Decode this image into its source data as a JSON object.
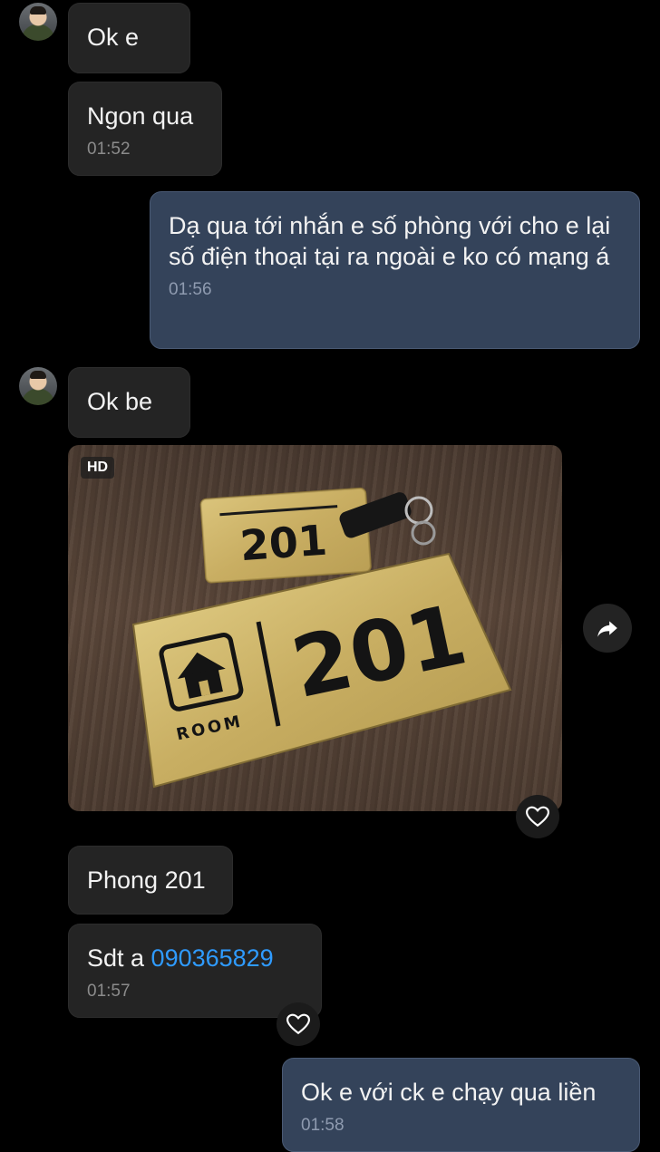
{
  "messages": {
    "m1": {
      "text": "Ok e"
    },
    "m2": {
      "text": "Ngon qua",
      "time": "01:52"
    },
    "m3": {
      "text": "Dạ qua tới nhắn e số phòng với cho e lại số điện thoại tại ra ngoài e ko có mạng á",
      "time": "01:56"
    },
    "m4": {
      "text": "Ok be"
    },
    "photo": {
      "badge": "HD",
      "sign_small_number": "201",
      "sign_big_number": "201",
      "sign_room_label": "ROOM"
    },
    "m5": {
      "text": "Phong 201"
    },
    "m6": {
      "prefix": "Sdt a ",
      "phone": "090365829",
      "time": "01:57"
    },
    "m7": {
      "text": "Ok e với ck e chạy qua liền",
      "time": "01:58"
    }
  },
  "colors": {
    "incoming": "#242424",
    "outgoing": "#34435a",
    "link": "#2f9bff"
  }
}
